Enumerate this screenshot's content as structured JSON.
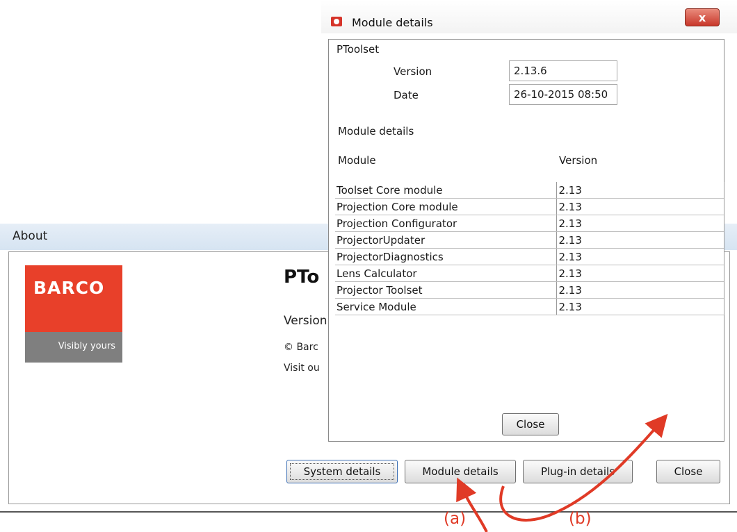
{
  "about_window": {
    "title": "About",
    "logo": {
      "brand": "BARCO",
      "tagline": "Visibly yours"
    },
    "app_name": "PTo",
    "version_text": "Version",
    "copyright_text": "© Barc",
    "visit_text": "Visit ou",
    "buttons": {
      "system_details": "System details",
      "module_details": "Module details",
      "plugin_details": "Plug-in details",
      "close": "Close"
    }
  },
  "module_dialog": {
    "title": "Module details",
    "close_glyph": "x",
    "group_title": "PToolset",
    "version_label": "Version",
    "version_value": "2.13.6",
    "date_label": "Date",
    "date_value": "26-10-2015 08:50",
    "section_title": "Module details",
    "columns": {
      "module": "Module",
      "version": "Version"
    },
    "rows": [
      {
        "module": "Toolset Core module",
        "version": "2.13"
      },
      {
        "module": "Projection Core module",
        "version": "2.13"
      },
      {
        "module": "Projection Configurator",
        "version": "2.13"
      },
      {
        "module": "ProjectorUpdater",
        "version": "2.13"
      },
      {
        "module": "ProjectorDiagnostics",
        "version": "2.13"
      },
      {
        "module": "Lens Calculator",
        "version": "2.13"
      },
      {
        "module": "Projector Toolset",
        "version": "2.13"
      },
      {
        "module": "Service Module",
        "version": "2.13"
      }
    ],
    "close_button": "Close"
  },
  "annotations": {
    "a": "(a)",
    "b": "(b)",
    "color": "#e03a26"
  },
  "colors": {
    "barco_red": "#e8402a",
    "barco_grey": "#7f7f7f",
    "title_close_red": "#c8372a"
  }
}
